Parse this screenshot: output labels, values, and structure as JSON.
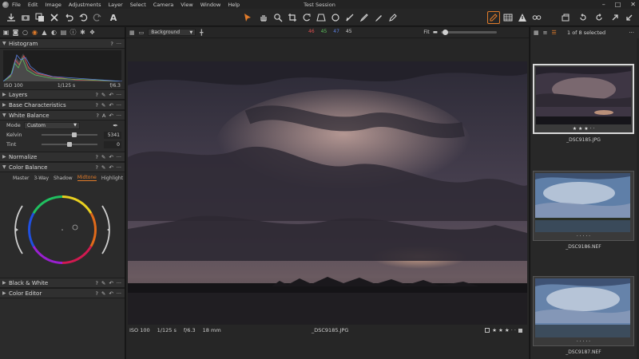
{
  "menu": [
    "File",
    "Edit",
    "Image",
    "Adjustments",
    "Layer",
    "Select",
    "Camera",
    "View",
    "Window",
    "Help"
  ],
  "session_title": "Test Session",
  "window_controls": {
    "min": "–",
    "max": "□",
    "close": "✕"
  },
  "toolbar": {
    "text_tool": "A"
  },
  "tool_tabs": [
    "library-icon",
    "camera-icon",
    "lens-icon",
    "color-icon",
    "exposure-icon",
    "details-icon",
    "adjustments-icon",
    "metadata-icon",
    "output-icon",
    "batch-icon"
  ],
  "histogram": {
    "title": "Histogram",
    "iso": "ISO 100",
    "shutter": "1/125 s",
    "aperture": "f/6.3"
  },
  "sections": {
    "layers": "Layers",
    "base": "Base Characteristics",
    "white_balance": "White Balance",
    "normalize": "Normalize",
    "color_balance": "Color Balance",
    "black_white": "Black & White",
    "color_editor": "Color Editor"
  },
  "white_balance": {
    "mode_label": "Mode",
    "mode_value": "Custom",
    "kelvin_label": "Kelvin",
    "kelvin_value": "5341",
    "kelvin_level": 0.6,
    "tint_label": "Tint",
    "tint_value": "0",
    "tint_level": 0.5,
    "wb_auto_label": "A"
  },
  "color_balance": {
    "tabs": [
      "Master",
      "3-Way",
      "Shadow",
      "Midtone",
      "Highlight"
    ],
    "active_tab": "Midtone"
  },
  "viewer": {
    "background": "Background",
    "rgb": {
      "r": "46",
      "g": "45",
      "b": "47",
      "l": "45"
    },
    "fit": "Fit",
    "iso": "ISO 100",
    "shutter": "1/125 s",
    "aperture": "f/6.3",
    "focal": "18 mm",
    "filename": "_DSC9185.JPG",
    "stars": "★ ★ ★ · ·"
  },
  "browser": {
    "selection": "1 of 8 selected",
    "thumbs": [
      {
        "caption": "_DSC9185.JPG",
        "stars": "★ ★ ★ · ·",
        "selected": true
      },
      {
        "caption": "_DSC9186.NEF",
        "stars": "· · · · ·",
        "selected": false
      },
      {
        "caption": "_DSC9187.NEF",
        "stars": "· · · · ·",
        "selected": false
      }
    ]
  },
  "colors": {
    "accent": "#e07b2a",
    "red_channel": "#e05050",
    "green_channel": "#5cc05c",
    "blue_channel": "#5b7fe0"
  }
}
